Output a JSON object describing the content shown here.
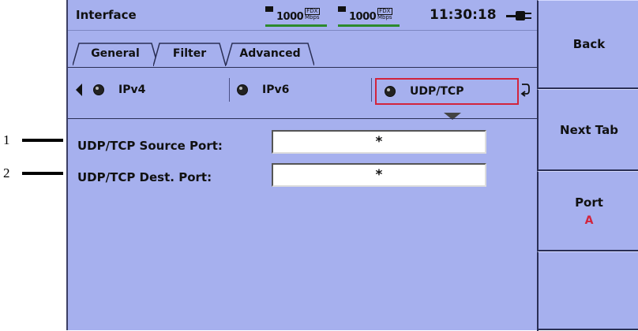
{
  "callouts": [
    "1",
    "2"
  ],
  "status": {
    "title": "Interface",
    "links": [
      {
        "speed": "1000",
        "duplex": "FDX",
        "unit": "Mbps",
        "icon": "link-led-icon"
      },
      {
        "speed": "1000",
        "duplex": "FDX",
        "unit": "Mbps",
        "icon": "link-led-icon"
      }
    ],
    "time": "11:30:18",
    "power_icon": "ac-plug-icon"
  },
  "tabs": [
    {
      "label": "General",
      "active": false
    },
    {
      "label": "Filter",
      "active": true
    },
    {
      "label": "Advanced",
      "active": false
    }
  ],
  "subtabs": [
    {
      "label": "IPv4",
      "active": false
    },
    {
      "label": "IPv6",
      "active": false
    },
    {
      "label": "UDP/TCP",
      "active": true
    }
  ],
  "fields": [
    {
      "label": "UDP/TCP Source Port:",
      "value": "*"
    },
    {
      "label": "UDP/TCP Dest. Port:",
      "value": "*"
    }
  ],
  "softkeys": {
    "back": "Back",
    "next_tab": "Next Tab",
    "port": "Port",
    "port_value": "A"
  },
  "colors": {
    "background": "#a6b0ee",
    "accent_red": "#d2243c",
    "link_green": "#2c8a2c"
  }
}
